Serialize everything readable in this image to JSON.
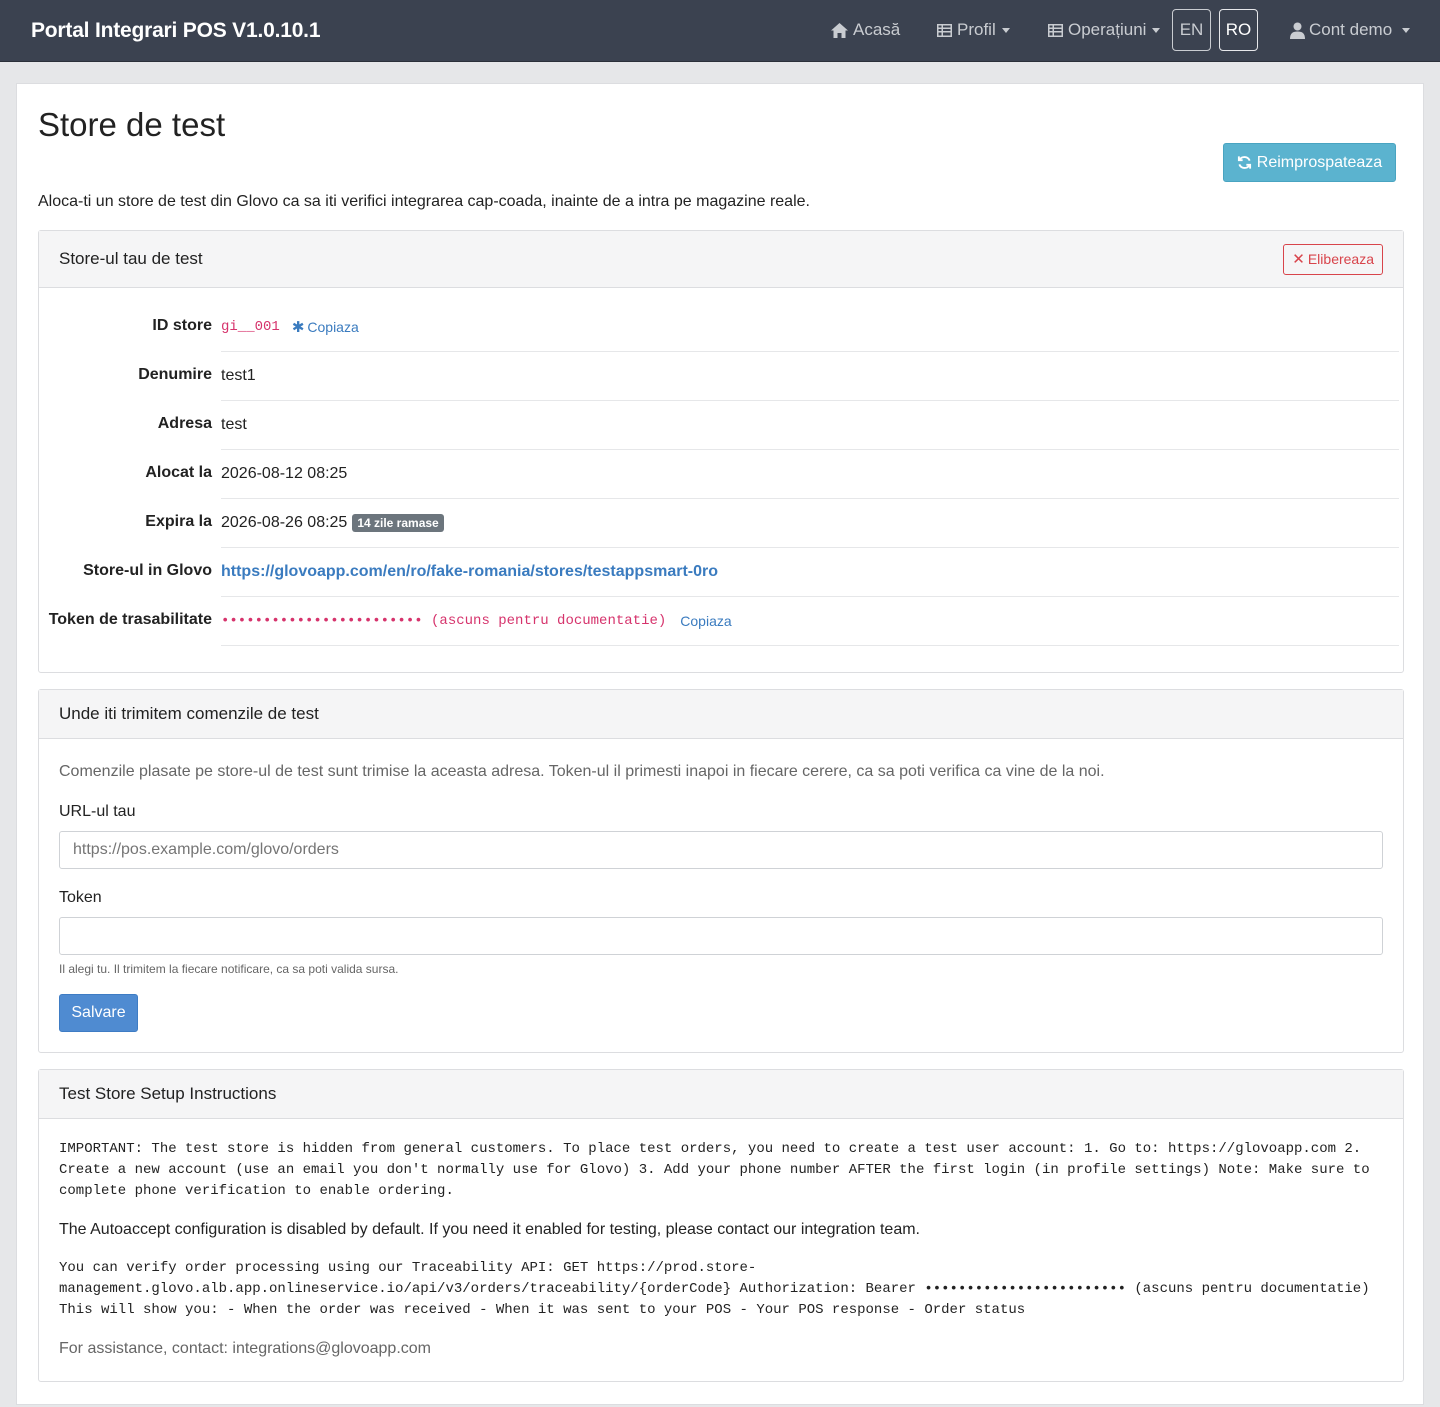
{
  "navbar": {
    "brand": "Portal Integrari POS V1.0.10.1",
    "home": "Acasă",
    "profile": "Profil",
    "operations": "Operațiuni",
    "lang_en": "EN",
    "lang_ro": "RO",
    "account": "Cont demo"
  },
  "page": {
    "title": "Store de test",
    "refresh": "Reimprospateaza",
    "intro": "Aloca-ti un store de test din Glovo ca sa iti verifici integrarea cap-coada, inainte de a intra pe magazine reale."
  },
  "store_panel": {
    "heading": "Store-ul tau de test",
    "release": "Elibereaza",
    "id_label": "ID store",
    "id_value": "gi__001",
    "id_copy": "Copiaza",
    "name_label": "Denumire",
    "name_value": "test1",
    "address_label": "Adresa",
    "address_value": "test",
    "allocated_label": "Alocat la",
    "allocated_value": "2026-08-12 08:25",
    "expires_label": "Expira la",
    "expires_value": "2026-08-26 08:25",
    "expires_badge": "14 zile ramase",
    "glovo_label": "Store-ul in Glovo",
    "glovo_url": "https://glovoapp.com/en/ro/fake-romania/stores/testappsmart-0ro",
    "token_label": "Token de trasabilitate",
    "token_value": "•••••••••••••••••••••••• (ascuns pentru documentatie)",
    "token_copy": "Copiaza"
  },
  "webhook_panel": {
    "heading": "Unde iti trimitem comenzile de test",
    "description": "Comenzile plasate pe store-ul de test sunt trimise la aceasta adresa. Token-ul il primesti inapoi in fiecare cerere, ca sa poti verifica ca vine de la noi.",
    "url_label": "URL-ul tau",
    "url_placeholder": "https://pos.example.com/glovo/orders",
    "token_label": "Token",
    "token_value": "",
    "token_help": "Il alegi tu. Il trimitem la fiecare notificare, ca sa poti valida sursa.",
    "save": "Salvare"
  },
  "instructions_panel": {
    "heading": "Test Store Setup Instructions",
    "important": "IMPORTANT: The test store is hidden from general customers. To place test orders, you need to create a test user account: 1. Go to: https://glovoapp.com 2. Create a new account (use an email you don't normally use for Glovo) 3. Add your phone number AFTER the first login (in profile settings) Note: Make sure to complete phone verification to enable ordering.",
    "autoaccept": "The Autoaccept configuration is disabled by default. If you need it enabled for testing, please contact our integration team.",
    "traceability": "You can verify order processing using our Traceability API: GET https://prod.store-management.glovo.alb.app.onlineservice.io/api/v3/orders/traceability/{orderCode} Authorization: Bearer •••••••••••••••••••••••• (ascuns pentru documentatie) This will show you: - When the order was received - When it was sent to your POS - Your POS response - Order status",
    "assistance": "For assistance, contact: integrations@glovoapp.com"
  }
}
